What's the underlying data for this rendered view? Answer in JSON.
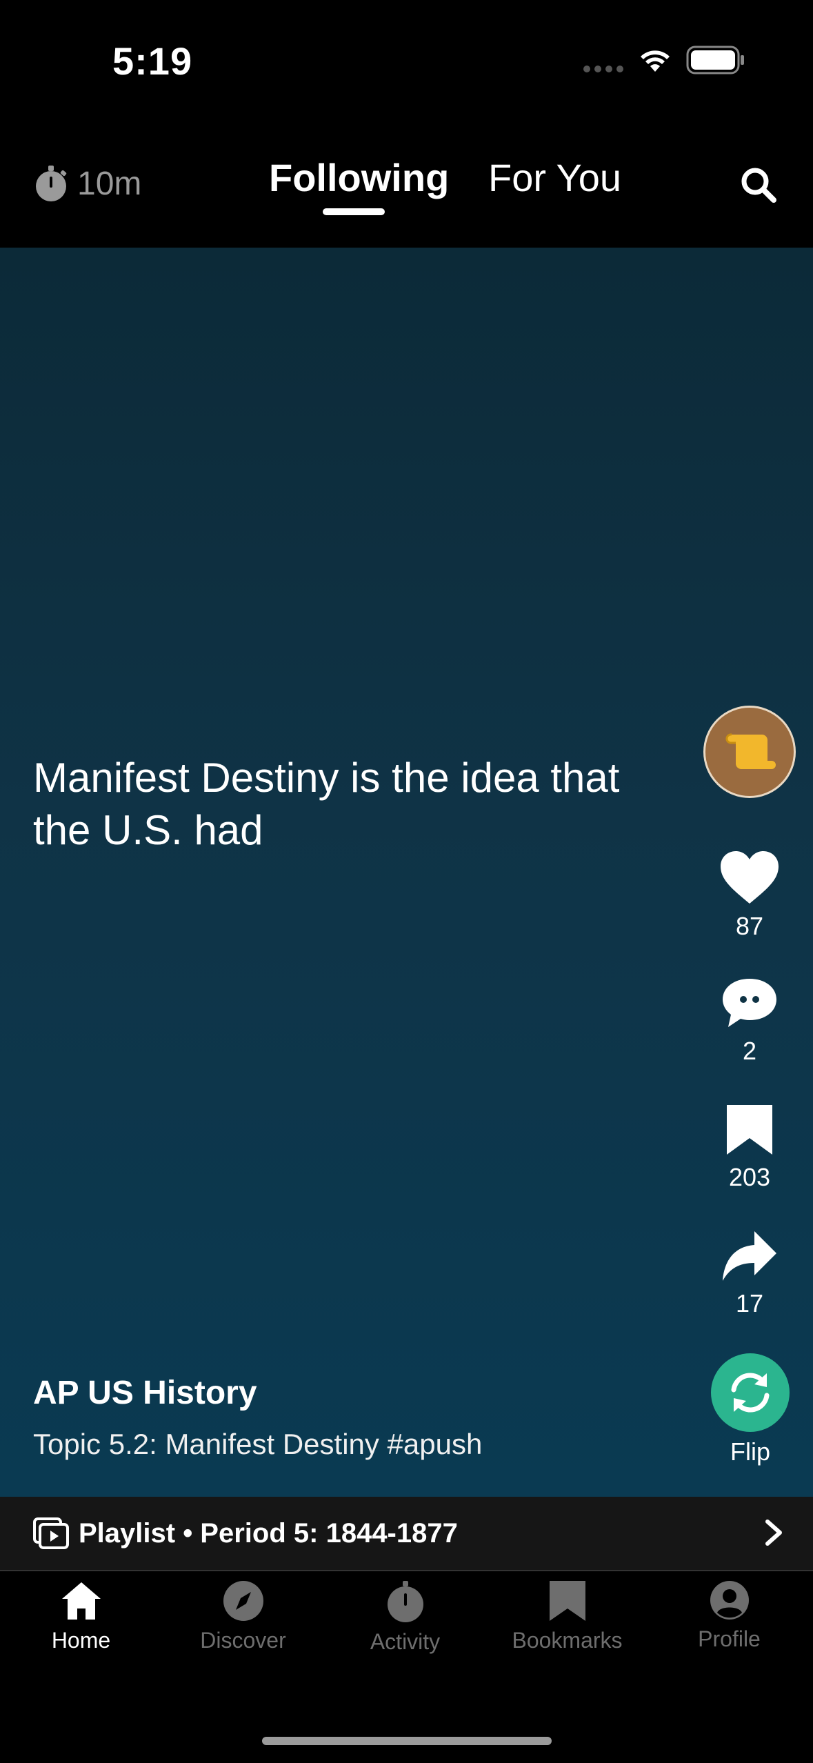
{
  "status_bar": {
    "time": "5:19"
  },
  "top_nav": {
    "timer": "10m",
    "tabs": [
      {
        "label": "Following",
        "active": true
      },
      {
        "label": "For You",
        "active": false
      }
    ]
  },
  "video": {
    "caption": "Manifest Destiny is the idea that the U.S. had",
    "course": "AP US History",
    "topic": "Topic 5.2: Manifest Destiny #apush"
  },
  "actions": {
    "likes": "87",
    "comments": "2",
    "bookmarks": "203",
    "shares": "17",
    "flip": "Flip"
  },
  "playlist": {
    "label": "Playlist • Period 5: 1844-1877"
  },
  "tab_bar": [
    {
      "label": "Home",
      "icon": "home-icon",
      "active": true
    },
    {
      "label": "Discover",
      "icon": "compass-icon",
      "active": false
    },
    {
      "label": "Activity",
      "icon": "stopwatch-icon",
      "active": false
    },
    {
      "label": "Bookmarks",
      "icon": "bookmark-icon",
      "active": false
    },
    {
      "label": "Profile",
      "icon": "person-icon",
      "active": false
    }
  ],
  "colors": {
    "flip_accent": "#2bb58f",
    "avatar_bg": "#9a6b3f",
    "scroll_icon": "#f2b72c"
  }
}
